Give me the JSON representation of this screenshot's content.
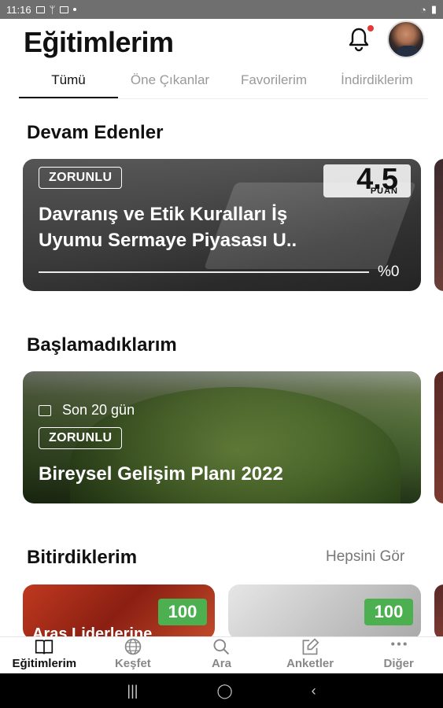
{
  "status_bar": {
    "time": "11:16"
  },
  "header": {
    "title": "Eğitimlerim"
  },
  "tabs": [
    {
      "label": "Tümü",
      "active": true
    },
    {
      "label": "Öne Çıkanlar",
      "active": false
    },
    {
      "label": "Favorilerim",
      "active": false
    },
    {
      "label": "İndirdiklerim",
      "active": false
    }
  ],
  "sections": {
    "ongoing": {
      "title": "Devam Edenler"
    },
    "not_started": {
      "title": "Başlamadıklarım"
    },
    "finished": {
      "title": "Bitirdiklerim",
      "see_all": "Hepsini Gör"
    }
  },
  "ongoing_card": {
    "tag": "ZORUNLU",
    "title_line1": "Davranış ve Etik Kuralları İş",
    "title_line2": "Uyumu Sermaye Piyasası U..",
    "score": "4.5",
    "score_unit": "PUAN",
    "progress_label": "%0",
    "progress_value": 0
  },
  "not_started_card": {
    "days": "Son 20 gün",
    "tag": "ZORUNLU",
    "title": "Bireysel Gelişim Planı 2022"
  },
  "finished_cards": [
    {
      "score": "100",
      "title": "Aras Liderlerine"
    },
    {
      "score": "100"
    }
  ],
  "bottom_nav": [
    {
      "label": "Eğitimlerim",
      "icon": "book-icon",
      "active": true
    },
    {
      "label": "Keşfet",
      "icon": "globe-icon",
      "active": false
    },
    {
      "label": "Ara",
      "icon": "search-icon",
      "active": false
    },
    {
      "label": "Anketler",
      "icon": "edit-icon",
      "active": false
    },
    {
      "label": "Diğer",
      "icon": "more-icon",
      "active": false
    }
  ],
  "colors": {
    "accent": "#4caf50",
    "badge": "#e53935"
  }
}
